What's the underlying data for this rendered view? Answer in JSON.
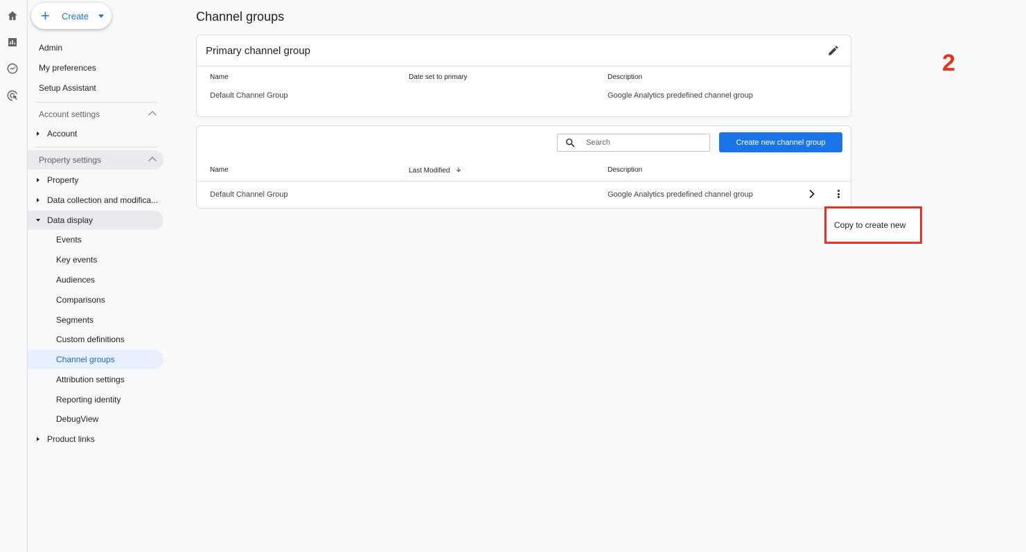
{
  "rail": {
    "icons": [
      "home-icon",
      "reports-icon",
      "explore-icon",
      "advertising-icon"
    ]
  },
  "sidebar": {
    "create_label": "Create",
    "links": [
      "Admin",
      "My preferences",
      "Setup Assistant"
    ],
    "account_settings": {
      "heading": "Account settings",
      "items": [
        "Account"
      ]
    },
    "property_settings": {
      "heading": "Property settings",
      "items": [
        "Property",
        "Data collection and modifica...",
        "Data display"
      ],
      "data_display_children": [
        "Events",
        "Key events",
        "Audiences",
        "Comparisons",
        "Segments",
        "Custom definitions",
        "Channel groups",
        "Attribution settings",
        "Reporting identity",
        "DebugView"
      ],
      "after_items": [
        "Product links"
      ]
    },
    "active_item": "Channel groups"
  },
  "main": {
    "title": "Channel groups",
    "primary_card": {
      "heading": "Primary channel group",
      "columns": [
        "Name",
        "Date set to primary",
        "Description"
      ],
      "row": [
        "Default Channel Group",
        "",
        "Google Analytics predefined channel group"
      ]
    },
    "list_card": {
      "search_placeholder": "Search",
      "create_button": "Create new channel group",
      "columns": [
        "Name",
        "Last Modified",
        "Description"
      ],
      "rows": [
        [
          "Default Channel Group",
          "",
          "Google Analytics predefined channel group"
        ]
      ]
    },
    "menu": {
      "items": [
        "Copy to create new"
      ]
    }
  },
  "annotation": {
    "step": "2",
    "color": "#e8321f"
  },
  "colors": {
    "accent": "#1a73e8",
    "active_bg": "#e8f0fe",
    "active_text": "#1967d2"
  }
}
